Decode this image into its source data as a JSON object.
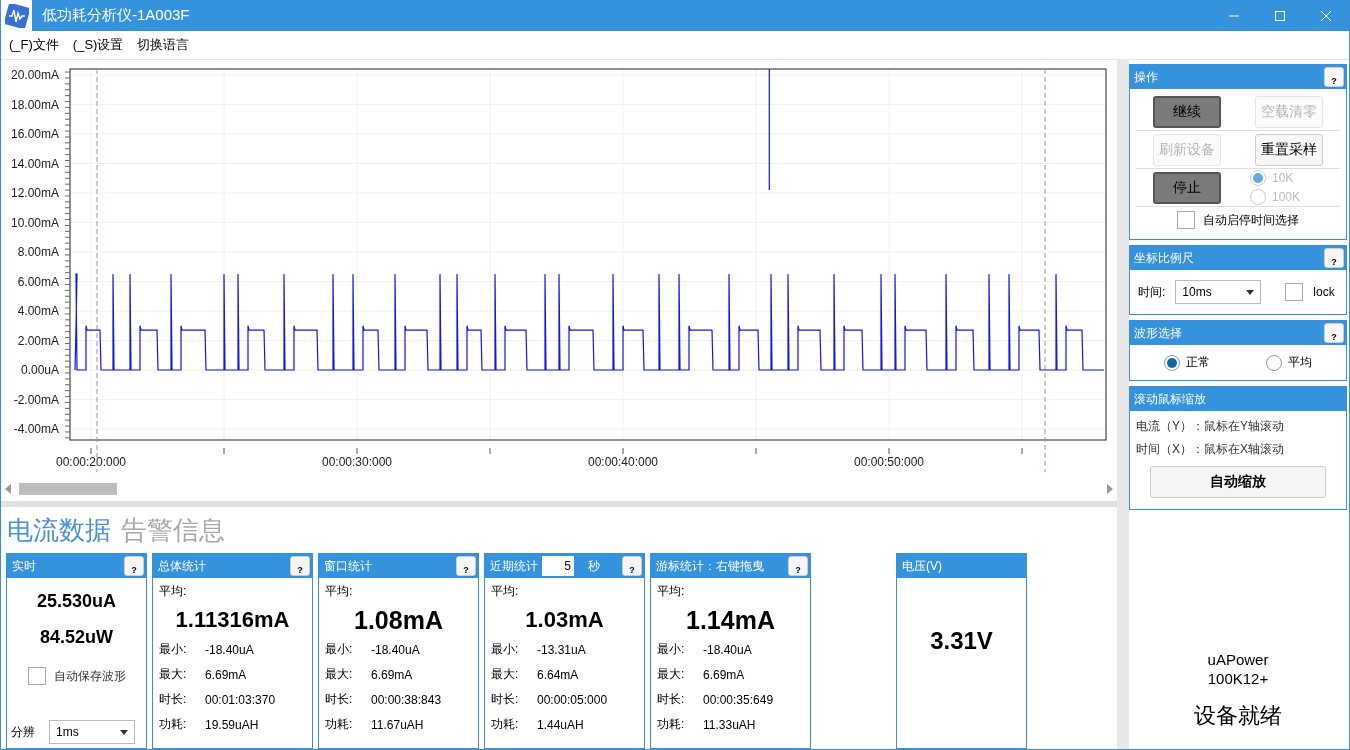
{
  "window": {
    "title": "低功耗分析仪-1A003F"
  },
  "menu": [
    {
      "label": "(_F)文件"
    },
    {
      "label": "(_S)设置"
    },
    {
      "label": "切换语言"
    }
  ],
  "chart": {
    "y_labels": [
      "20.00mA",
      "18.00mA",
      "16.00mA",
      "14.00mA",
      "12.00mA",
      "10.00mA",
      "8.00mA",
      "6.00mA",
      "4.00mA",
      "2.00mA",
      "0.00uA",
      "-2.00mA",
      "-4.00mA"
    ],
    "x_labels": [
      "00:00:20:000",
      "00:00:30:000",
      "00:00:40:000",
      "00:00:50:000"
    ]
  },
  "data_tabs": [
    {
      "label": "电流数据",
      "selected": true
    },
    {
      "label": "告警信息",
      "selected": false
    }
  ],
  "cards": [
    {
      "kind": "realtime",
      "title": "实时",
      "help": "?",
      "current": "25.530uA",
      "power": "84.52uW",
      "auto_save": {
        "label": "自动保存波形",
        "checked": false
      },
      "resolution": {
        "label": "分辨",
        "value": "1ms"
      }
    },
    {
      "kind": "stats",
      "title": "总体统计",
      "help": "?",
      "avg_label": "平均:",
      "avg": "1.11316mA",
      "rows": [
        {
          "label": "最小:",
          "value": "-18.40uA"
        },
        {
          "label": "最大:",
          "value": "6.69mA"
        },
        {
          "label": "时长:",
          "value": "00:01:03:370"
        },
        {
          "label": "功耗:",
          "value": "19.59uAH"
        }
      ]
    },
    {
      "kind": "stats",
      "title": "窗口统计",
      "help": "?",
      "avg_label": "平均:",
      "avg": "1.08mA",
      "big": true,
      "rows": [
        {
          "label": "最小:",
          "value": "-18.40uA"
        },
        {
          "label": "最大:",
          "value": "6.69mA"
        },
        {
          "label": "时长:",
          "value": "00:00:38:843"
        },
        {
          "label": "功耗:",
          "value": "11.67uAH"
        }
      ]
    },
    {
      "kind": "stats",
      "title": "近期统计",
      "seconds": "5",
      "unit": "秒",
      "help": "?",
      "avg_label": "平均:",
      "avg": "1.03mA",
      "rows": [
        {
          "label": "最小:",
          "value": "-13.31uA"
        },
        {
          "label": "最大:",
          "value": "6.64mA"
        },
        {
          "label": "时长:",
          "value": "00:00:05:000"
        },
        {
          "label": "功耗:",
          "value": "1.44uAH"
        }
      ]
    },
    {
      "kind": "stats",
      "title": "游标统计：右键拖曳",
      "help": "?",
      "avg_label": "平均:",
      "avg": "1.14mA",
      "big": true,
      "rows": [
        {
          "label": "最小:",
          "value": "-18.40uA"
        },
        {
          "label": "最大:",
          "value": "6.69mA"
        },
        {
          "label": "时长:",
          "value": "00:00:35:649"
        },
        {
          "label": "功耗:",
          "value": "11.33uAH"
        }
      ]
    },
    {
      "kind": "voltage",
      "title": "电压(V)",
      "value": "3.31V"
    }
  ],
  "panels": [
    {
      "kind": "operations",
      "title": "操作",
      "help": "?",
      "buttons": [
        {
          "label": "继续",
          "pressed": true,
          "disabled": false
        },
        {
          "label": "空载清零",
          "pressed": false,
          "disabled": true
        },
        {
          "label": "刷新设备",
          "pressed": false,
          "disabled": true
        },
        {
          "label": "重置采样",
          "pressed": false,
          "disabled": false
        },
        {
          "label": "停止",
          "pressed": true,
          "disabled": false
        }
      ],
      "rates": [
        {
          "label": "10K",
          "selected": true,
          "disabled": true
        },
        {
          "label": "100K",
          "selected": false,
          "disabled": true
        }
      ],
      "auto": {
        "label": "自动启停时间选择",
        "checked": false
      }
    },
    {
      "kind": "scale",
      "title": "坐标比例尺",
      "help": "?",
      "time_label": "时间:",
      "time_value": "10ms",
      "lock": {
        "label": "lock",
        "checked": false
      }
    },
    {
      "kind": "wave",
      "title": "波形选择",
      "help": "?",
      "options": [
        {
          "label": "正常",
          "selected": true
        },
        {
          "label": "平均",
          "selected": false
        }
      ]
    },
    {
      "kind": "zoom",
      "title": "滚动鼠标缩放",
      "lines": [
        "电流（Y）：鼠标在Y轴滚动",
        "时间（X）：鼠标在X轴滚动"
      ],
      "button": "自动缩放"
    }
  ],
  "device": {
    "model": "uAPower",
    "variant": "100K12+",
    "status": "设备就绪"
  }
}
